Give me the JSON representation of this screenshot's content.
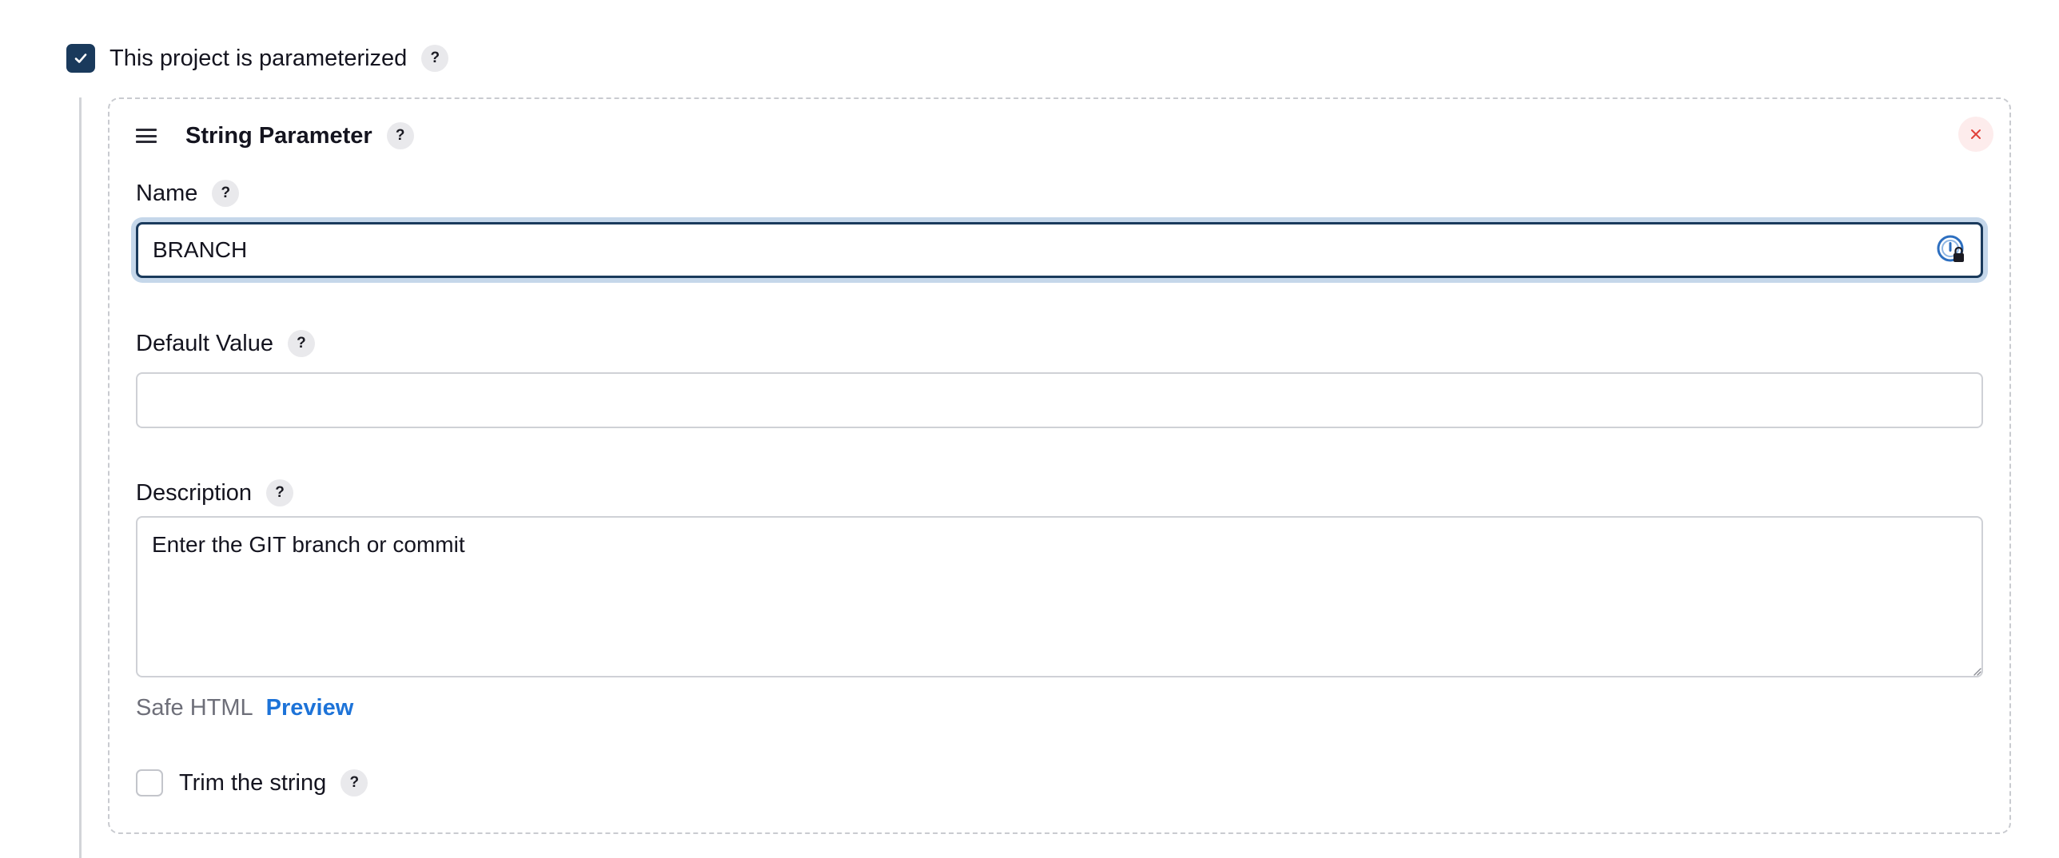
{
  "project": {
    "parameterized_label": "This project is parameterized",
    "parameterized_checked": true,
    "help": "?"
  },
  "parameter": {
    "title": "String Parameter",
    "title_help": "?",
    "close_icon": "×",
    "name": {
      "label": "Name",
      "help": "?",
      "value": "BRANCH"
    },
    "default_value": {
      "label": "Default Value",
      "help": "?",
      "value": ""
    },
    "description": {
      "label": "Description",
      "help": "?",
      "value": "Enter the GIT branch or commit"
    },
    "safe_html": "Safe HTML",
    "preview": "Preview",
    "trim": {
      "label": "Trim the string",
      "help": "?",
      "checked": false
    }
  },
  "icons": {
    "checkbox": "checkmark-icon",
    "drag": "drag-handle-icon",
    "close": "close-icon",
    "password_manager": "password-manager-icon"
  },
  "colors": {
    "accent_dark": "#1a3a5c",
    "link": "#1d73d8",
    "close_red": "#e0413a"
  }
}
